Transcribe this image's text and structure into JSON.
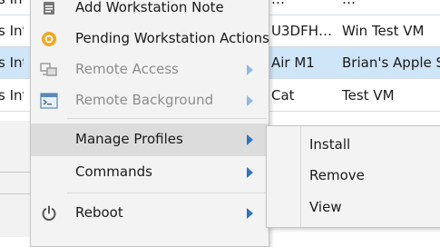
{
  "table": {
    "rows": [
      {
        "c0": "s Int",
        "c1": "…",
        "c2": "…",
        "highlight": false
      },
      {
        "c0": "s Int",
        "c1": "U3DFH…",
        "c2": "Win Test VM",
        "highlight": false
      },
      {
        "c0": "s Int",
        "c1": "Air M1",
        "c2": "Brian's Apple Si",
        "highlight": true
      },
      {
        "c0": "s Int",
        "c1": "Cat",
        "c2": "Test VM",
        "highlight": false
      }
    ]
  },
  "menu": {
    "items": [
      {
        "label": "Add Workstation Note",
        "icon": "note-icon"
      },
      {
        "label": "Pending Workstation Actions",
        "icon": "pending-actions-icon"
      },
      {
        "label": "Remote Access",
        "icon": "remote-access-icon",
        "disabled": true
      },
      {
        "label": "Remote Background",
        "icon": "terminal-icon",
        "disabled": true
      },
      {
        "label": "Manage Profiles",
        "active": true
      },
      {
        "label": "Commands"
      },
      {
        "label": "Reboot",
        "icon": "power-icon"
      }
    ]
  },
  "submenu": {
    "items": [
      "Install",
      "Remove",
      "View"
    ]
  },
  "colors": {
    "accent_arrow": "#2f74c0",
    "row_highlight": "#cfe5f8",
    "pending_icon": "#f2a51f"
  }
}
